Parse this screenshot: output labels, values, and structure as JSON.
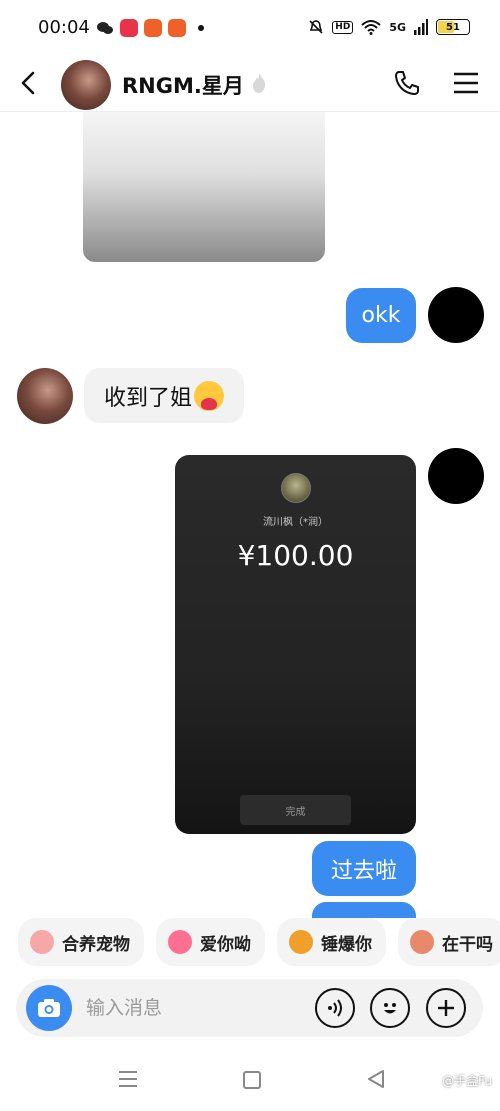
{
  "status_bar": {
    "time": "00:04",
    "network": "5G",
    "hd": "HD",
    "battery": "51"
  },
  "header": {
    "contact_name": "RNGM.星月"
  },
  "messages": {
    "okk": "okk",
    "received": "收到了姐",
    "sent_later": "过去啦"
  },
  "transfer": {
    "payee": "流川枫（*润）",
    "amount": "¥100.00",
    "done_label": "完成"
  },
  "quick_actions": [
    {
      "label": "合养宠物",
      "color": "#f7a7a7"
    },
    {
      "label": "爱你呦",
      "color": "#ff6f91"
    },
    {
      "label": "锤爆你",
      "color": "#f0a028"
    },
    {
      "label": "在干吗",
      "color": "#e88a6a"
    }
  ],
  "input": {
    "placeholder": "输入消息"
  },
  "watermark": "@手盒Fu",
  "colors": {
    "accent": "#3b8cf0"
  }
}
